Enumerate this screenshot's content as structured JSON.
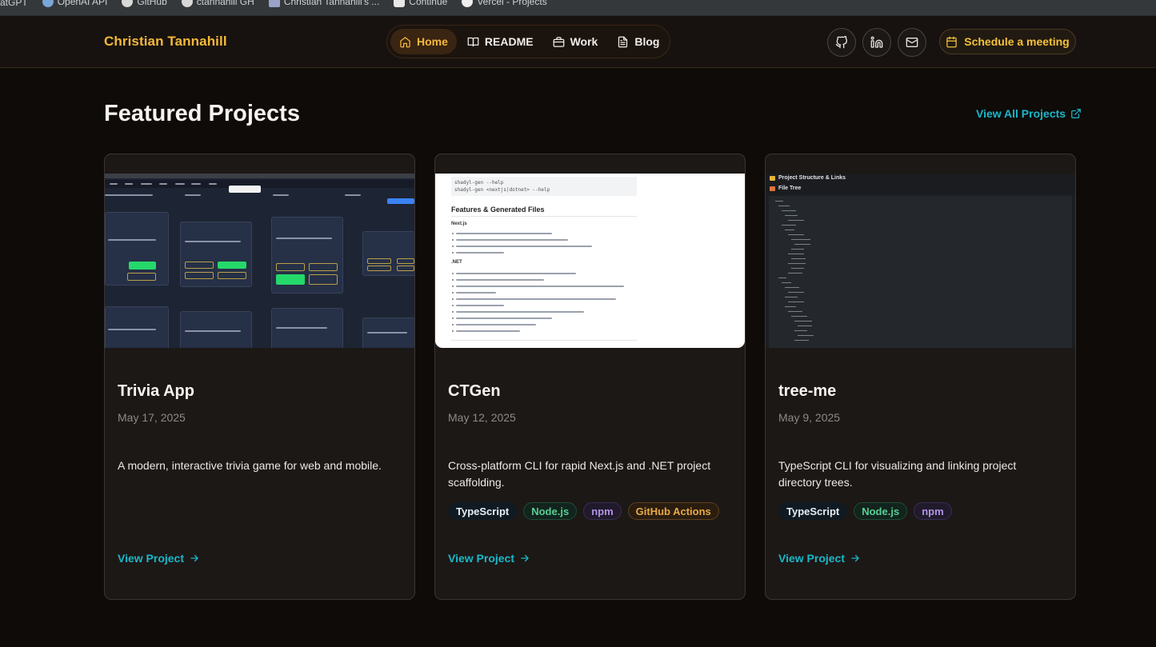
{
  "bookmarks": [
    {
      "label": "atGPT",
      "icon": "chatgpt-icon"
    },
    {
      "label": "OpenAI API",
      "icon": "openai-icon"
    },
    {
      "label": "GitHub",
      "icon": "github-icon"
    },
    {
      "label": "ctannahill GH",
      "icon": "github-icon"
    },
    {
      "label": "Christian Tannahill's ...",
      "icon": "image-icon"
    },
    {
      "label": "Continue",
      "icon": "continue-icon"
    },
    {
      "label": "Vercel - Projects",
      "icon": "vercel-icon"
    }
  ],
  "header": {
    "brand": "Christian Tannahill",
    "nav": [
      {
        "label": "Home",
        "icon": "home-icon",
        "active": true
      },
      {
        "label": "README",
        "icon": "book-icon",
        "active": false
      },
      {
        "label": "Work",
        "icon": "briefcase-icon",
        "active": false
      },
      {
        "label": "Blog",
        "icon": "document-icon",
        "active": false
      }
    ],
    "social_icons": [
      "github-icon",
      "linkedin-icon",
      "mail-icon"
    ],
    "schedule_label": "Schedule a meeting"
  },
  "section": {
    "title": "Featured Projects",
    "view_all": "View All Projects"
  },
  "projects": [
    {
      "title": "Trivia App",
      "date": "May 17, 2025",
      "description": "A modern, interactive trivia game for web and mobile.",
      "tags": [],
      "link": "View Project"
    },
    {
      "title": "CTGen",
      "date": "May 12, 2025",
      "description": "Cross-platform CLI for rapid Next.js and .NET project scaffolding.",
      "tags": [
        "TypeScript",
        "Node.js",
        "npm",
        "GitHub Actions"
      ],
      "link": "View Project"
    },
    {
      "title": "tree-me",
      "date": "May 9, 2025",
      "description": "TypeScript CLI for visualizing and linking project directory trees.",
      "tags": [
        "TypeScript",
        "Node.js",
        "npm"
      ],
      "link": "View Project"
    }
  ],
  "thumb_ctgen": {
    "cmd1": "shadyl-gen --help",
    "cmd2": "shadyl-gen <nextjs|dotnet> --help",
    "heading": "Features & Generated Files",
    "sub1": "Next.js",
    "sub2": ".NET"
  },
  "thumb_tree": {
    "label1": "Project Structure & Links",
    "label2": "File Tree"
  },
  "colors": {
    "accent_gold": "#f5b93a",
    "accent_teal": "#19b8c8",
    "background": "#0e0b09",
    "card": "#1c1816"
  }
}
